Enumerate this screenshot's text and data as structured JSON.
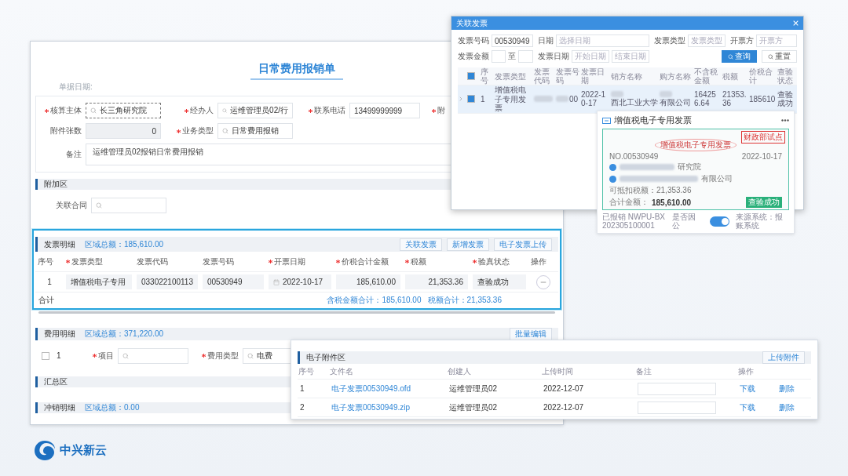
{
  "form": {
    "title": "日常费用报销单",
    "date_label": "单据日期:",
    "fields": [
      {
        "label": "核算主体",
        "required": true,
        "value": "长三角研究院",
        "kind": "lookup",
        "focused": true
      },
      {
        "label": "经办人",
        "required": true,
        "value": "运维管理员02/行",
        "kind": "lookup",
        "focused": false
      },
      {
        "label": "联系电话",
        "required": true,
        "value": "13499999999",
        "kind": "text",
        "focused": false
      },
      {
        "label": "附",
        "required": true,
        "kind": "cut"
      },
      {
        "label": "附件张数",
        "required": false,
        "value": "0",
        "kind": "disabled",
        "focused": false
      },
      {
        "label": "业务类型",
        "required": true,
        "value": "日常费用报销",
        "kind": "lookup",
        "focused": false
      }
    ],
    "remark": {
      "label": "备注",
      "value": "运维管理员02报销日常费用报销"
    }
  },
  "sections": [
    {
      "kind": "fields",
      "title": "附加区",
      "fields": [
        {
          "label": "关联合同",
          "required": false
        }
      ]
    },
    {
      "kind": "invoice_table",
      "title": "发票明细",
      "total": "区域总额：185,610.00",
      "highlighted": true,
      "buttons": [
        "关联发票",
        "新增发票",
        "电子发票上传"
      ],
      "columns": [
        {
          "label": "序号",
          "required": false
        },
        {
          "label": "发票类型",
          "required": true
        },
        {
          "label": "发票代码",
          "required": false
        },
        {
          "label": "发票号码",
          "required": false
        },
        {
          "label": "开票日期",
          "required": true
        },
        {
          "label": "价税合计金额",
          "required": true
        },
        {
          "label": "税额",
          "required": true
        },
        {
          "label": "验真状态",
          "required": true
        },
        {
          "label": "操作",
          "required": false
        }
      ],
      "rows": [
        {
          "cells": [
            {
              "kind": "text",
              "value": "1"
            },
            {
              "kind": "select",
              "value": "增值税电子专用"
            },
            {
              "kind": "field",
              "value": "033022100113"
            },
            {
              "kind": "field",
              "value": "00530949"
            },
            {
              "kind": "date",
              "value": "2022-10-17"
            },
            {
              "kind": "amount",
              "value": "185,610.00"
            },
            {
              "kind": "amount",
              "value": "21,353.36"
            },
            {
              "kind": "field",
              "value": "查验成功"
            },
            {
              "kind": "action"
            }
          ]
        }
      ],
      "summary": {
        "label": "合计",
        "amounts": [
          "含税金额合计：185,610.00",
          "税额合计：21,353.36"
        ]
      }
    },
    {
      "kind": "expense_row",
      "title": "费用明细",
      "total": "区域总额：371,220.00",
      "buttons": [
        "批量编辑"
      ],
      "row": {
        "index": "1",
        "checked": false,
        "fields": [
          {
            "label": "项目",
            "required": true
          },
          {
            "label": "费用类型",
            "required": true,
            "value": "电费"
          }
        ]
      }
    },
    {
      "kind": "empty",
      "title": "汇总区"
    },
    {
      "kind": "empty",
      "title": "冲销明细",
      "total": "区域总额：0.00"
    }
  ],
  "dialog": {
    "title": "关联发票",
    "filters": [
      {
        "label": "发票号码",
        "value": "00530949"
      },
      {
        "label": "日期",
        "placeholder": "选择日期"
      },
      {
        "label": "发票类型",
        "placeholder": "发票类型"
      },
      {
        "label": "开票方",
        "placeholder": "开票方"
      },
      {
        "label": "发票金额",
        "separator": "至"
      },
      {
        "label": "发票日期",
        "from": "开始日期",
        "to": "结束日期"
      }
    ],
    "buttons": [
      {
        "label": "查询",
        "primary": true
      },
      {
        "label": "重置",
        "primary": false
      }
    ],
    "all_checked": true,
    "columns": [
      "序号",
      "发票类型",
      "发票代码",
      "发票号码",
      "发票日期",
      "销方名称",
      "购方名称",
      "不含税金额",
      "税额",
      "价税合计",
      "查验状态"
    ],
    "rows": [
      {
        "checked": true,
        "selected": true,
        "cells": [
          {
            "value": "1"
          },
          {
            "value": "增值税电子专用发票"
          },
          {
            "redacted": true
          },
          {
            "value": "00",
            "redacted": true
          },
          {
            "value": "2022-10-17"
          },
          {
            "value": "西北工业大学",
            "redacted": true
          },
          {
            "value": "有限公司",
            "redacted": true
          },
          {
            "value": "164256.64"
          },
          {
            "value": "21353.36"
          },
          {
            "value": "185610"
          },
          {
            "value": "查验成功"
          }
        ]
      }
    ],
    "card": {
      "title": "增值税电子专用发票",
      "stamp": "财政部试点",
      "heading": "增值税电子专用发票",
      "number": "NO.00530949",
      "date": "2022-10-17",
      "buyer": "研究院",
      "seller": "有限公司",
      "deductible": "可抵扣税额：21,353.36",
      "total_label": "合计金额：",
      "total": "185,610.00",
      "status": "查验成功",
      "reimbursed": "已报销 NWPU-BX202305100001",
      "toggle_label": "是否因公",
      "toggle_on": true,
      "source": "来源系统：报账系统"
    }
  },
  "attachments": {
    "title": "电子附件区",
    "button": "上传附件",
    "columns": [
      "序号",
      "文件名",
      "创建人",
      "上传时间",
      "备注",
      "操作"
    ],
    "rows": [
      {
        "index": "1",
        "file": "电子发票00530949.ofd",
        "creator": "运维管理员02",
        "time": "2022-12-07",
        "actions": [
          "下载",
          "删除"
        ]
      },
      {
        "index": "2",
        "file": "电子发票00530949.zip",
        "creator": "运维管理员02",
        "time": "2022-12-07",
        "actions": [
          "下载",
          "删除"
        ]
      }
    ]
  },
  "logo": {
    "name": "中兴新云"
  }
}
